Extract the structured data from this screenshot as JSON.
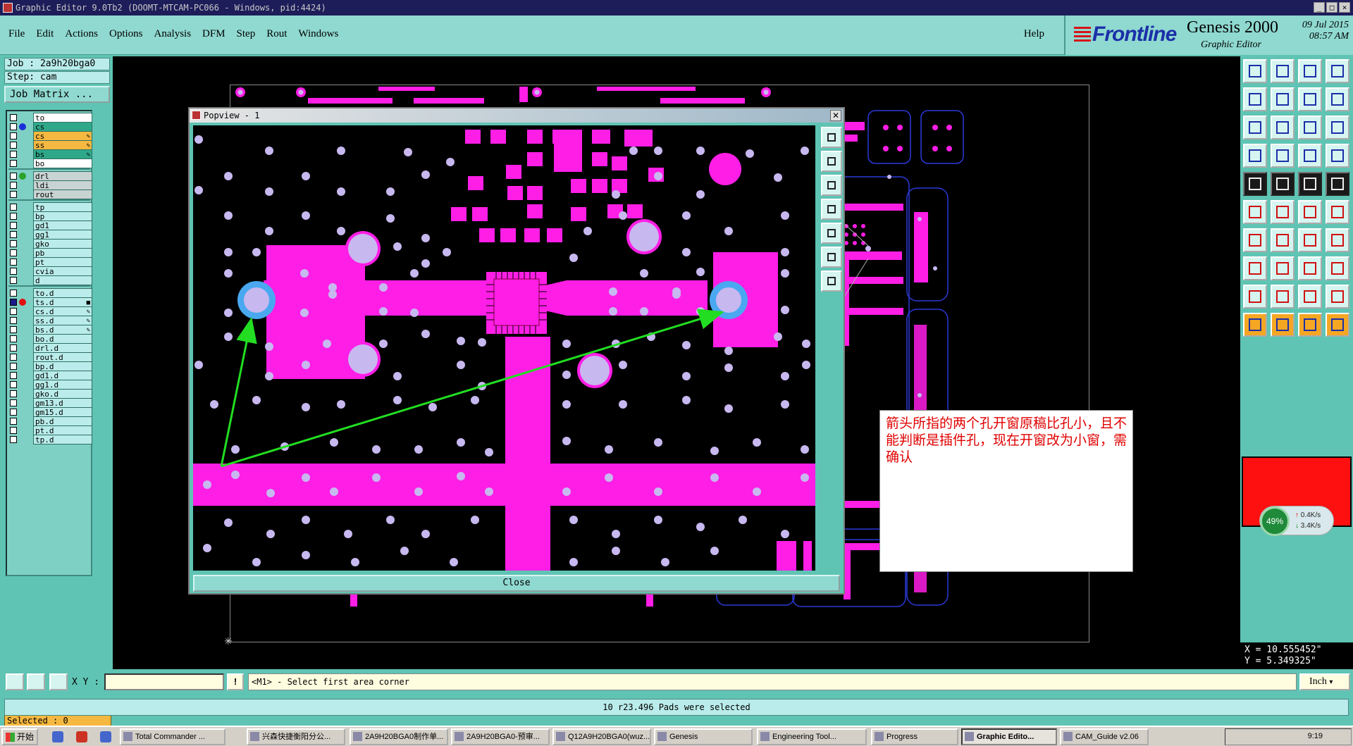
{
  "window": {
    "title": "Graphic Editor 9.0Tb2 (DOOMT-MTCAM-PC066 - Windows, pid:4424)"
  },
  "menu": {
    "items": [
      "File",
      "Edit",
      "Actions",
      "Options",
      "Analysis",
      "DFM",
      "Step",
      "Rout",
      "Windows"
    ],
    "help": "Help"
  },
  "brand": {
    "logo": "Frontline",
    "product": "Genesis 2000",
    "subtitle": "Graphic Editor",
    "date": "09 Jul 2015",
    "time": "08:57 AM"
  },
  "job": {
    "job_line": "Job : 2a9h20bga0",
    "step_line": "Step: cam",
    "matrix_button": "Job Matrix ..."
  },
  "layers": [
    {
      "name": "to",
      "style": "white"
    },
    {
      "name": "cs",
      "style": "green",
      "dot": "#1b2fd8"
    },
    {
      "name": "cs",
      "style": "orange",
      "mark": "✎"
    },
    {
      "name": "ss",
      "style": "orange",
      "mark": "✎"
    },
    {
      "name": "bs",
      "style": "green",
      "mark": "✎"
    },
    {
      "name": "bo",
      "style": "white"
    },
    {
      "name": "drl",
      "style": "gray",
      "dot": "#2aa22a"
    },
    {
      "name": "ldi",
      "style": "gray"
    },
    {
      "name": "rout",
      "style": "gray"
    },
    {
      "name": "tp"
    },
    {
      "name": "bp"
    },
    {
      "name": "gd1"
    },
    {
      "name": "gg1"
    },
    {
      "name": "gko"
    },
    {
      "name": "pb"
    },
    {
      "name": "pt"
    },
    {
      "name": "cvia"
    },
    {
      "name": "d"
    },
    {
      "name": "to.d"
    },
    {
      "name": "ts.d",
      "dot": "#e01010",
      "checked": true,
      "mark": "■"
    },
    {
      "name": "cs.d",
      "mark": "✎"
    },
    {
      "name": "ss.d",
      "mark": "✎"
    },
    {
      "name": "bs.d",
      "mark": "✎"
    },
    {
      "name": "bo.d"
    },
    {
      "name": "drl.d"
    },
    {
      "name": "rout.d"
    },
    {
      "name": "bp.d"
    },
    {
      "name": "gd1.d"
    },
    {
      "name": "gg1.d"
    },
    {
      "name": "gko.d"
    },
    {
      "name": "gm13.d"
    },
    {
      "name": "gm15.d"
    },
    {
      "name": "pb.d"
    },
    {
      "name": "pt.d"
    },
    {
      "name": "tp.d"
    }
  ],
  "selected_label": "Selected : 0",
  "popview": {
    "title": "Popview - 1",
    "close_label": "Close",
    "close_x": "✕"
  },
  "note": {
    "text": "箭头所指的两个孔开窗原稿比孔小，且不能判断是插件孔，现在开窗改为小窗，需确认"
  },
  "coords": {
    "x": "X = 10.555452\"",
    "y": "Y = 5.349325\""
  },
  "netmeter": {
    "percent": "49%",
    "up": "0.4K/s",
    "down": "3.4K/s"
  },
  "command": {
    "xy_label": "X Y :",
    "xy_value": "",
    "bang": "!",
    "prompt": "<M1> - Select first area corner",
    "unit": "Inch"
  },
  "status": "10 r23.496 Pads were selected",
  "taskbar": {
    "start": "开始",
    "tasks": [
      "Total Commander ...",
      "兴森快捷衡阳分公...",
      "2A9H20BGA0制作单...",
      "2A9H20BGA0-预审...",
      "Q12A9H20BGA0(wuz...",
      "Genesis",
      "Engineering Tool...",
      "Progress",
      "Graphic Edito...",
      "CAM_Guide v2.06"
    ],
    "active_index": 8,
    "clock": "9:19"
  },
  "colors": {
    "teal": "#5fc4b4",
    "magenta": "#ff1ee6",
    "hole": "#c8b8f0",
    "accent_red": "#e00000",
    "arrow_green": "#22dd22"
  }
}
